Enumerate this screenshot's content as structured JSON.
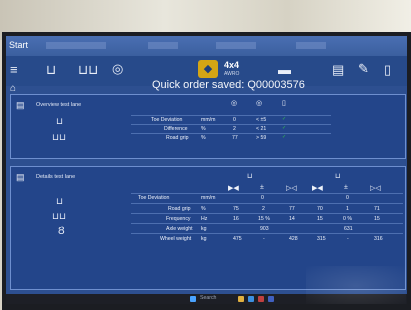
{
  "window": {
    "start_label": "Start"
  },
  "toolbar": {
    "brand_label": "4x4",
    "brand_sub": "AWRO"
  },
  "message": {
    "text": "Quick order saved: Q00003576"
  },
  "overview": {
    "title": "Overview test lane",
    "rows": [
      {
        "label": "Toe Deviation",
        "unit": "mm/m",
        "value": "0",
        "limit": "< ±5",
        "status": "ok"
      },
      {
        "label": "Difference",
        "unit": "%",
        "value": "2",
        "limit": "< 21",
        "status": "ok"
      },
      {
        "label": "Road grip",
        "unit": "%",
        "value": "77",
        "limit": "> 59",
        "status": "ok"
      }
    ]
  },
  "details": {
    "title": "Details test lane",
    "toe": {
      "label": "Toe Deviation",
      "unit": "mm/m",
      "front": "0",
      "rear": "0"
    },
    "rows": [
      {
        "label": "Road grip",
        "unit": "%",
        "front": [
          "75",
          "2",
          "77"
        ],
        "rear": [
          "70",
          "1",
          "71"
        ]
      },
      {
        "label": "Frequency",
        "unit": "Hz",
        "front": [
          "16",
          "15 %",
          "14"
        ],
        "rear": [
          "15",
          "0 %",
          "15"
        ]
      },
      {
        "label": "Axle weight",
        "unit": "kg",
        "front": [
          "",
          "903",
          ""
        ],
        "rear": [
          "",
          "631",
          ""
        ]
      },
      {
        "label": "Wheel weight",
        "unit": "kg",
        "front": [
          "475",
          "-",
          "428"
        ],
        "rear": [
          "315",
          "-",
          "316"
        ]
      }
    ]
  },
  "taskbar": {
    "search_label": "Search"
  },
  "colors": {
    "screen_bg": "#2d4f90",
    "ok_green": "#32c24a",
    "brand_yellow": "#d4a514"
  }
}
